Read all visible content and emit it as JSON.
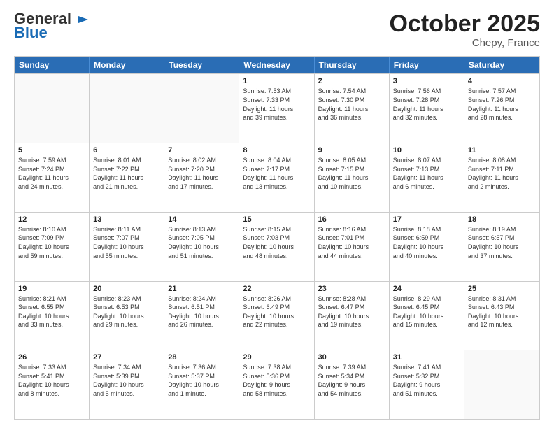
{
  "header": {
    "logo_general": "General",
    "logo_blue": "Blue",
    "month": "October 2025",
    "location": "Chepy, France"
  },
  "weekdays": [
    "Sunday",
    "Monday",
    "Tuesday",
    "Wednesday",
    "Thursday",
    "Friday",
    "Saturday"
  ],
  "rows": [
    [
      {
        "day": "",
        "info": ""
      },
      {
        "day": "",
        "info": ""
      },
      {
        "day": "",
        "info": ""
      },
      {
        "day": "1",
        "info": "Sunrise: 7:53 AM\nSunset: 7:33 PM\nDaylight: 11 hours\nand 39 minutes."
      },
      {
        "day": "2",
        "info": "Sunrise: 7:54 AM\nSunset: 7:30 PM\nDaylight: 11 hours\nand 36 minutes."
      },
      {
        "day": "3",
        "info": "Sunrise: 7:56 AM\nSunset: 7:28 PM\nDaylight: 11 hours\nand 32 minutes."
      },
      {
        "day": "4",
        "info": "Sunrise: 7:57 AM\nSunset: 7:26 PM\nDaylight: 11 hours\nand 28 minutes."
      }
    ],
    [
      {
        "day": "5",
        "info": "Sunrise: 7:59 AM\nSunset: 7:24 PM\nDaylight: 11 hours\nand 24 minutes."
      },
      {
        "day": "6",
        "info": "Sunrise: 8:01 AM\nSunset: 7:22 PM\nDaylight: 11 hours\nand 21 minutes."
      },
      {
        "day": "7",
        "info": "Sunrise: 8:02 AM\nSunset: 7:20 PM\nDaylight: 11 hours\nand 17 minutes."
      },
      {
        "day": "8",
        "info": "Sunrise: 8:04 AM\nSunset: 7:17 PM\nDaylight: 11 hours\nand 13 minutes."
      },
      {
        "day": "9",
        "info": "Sunrise: 8:05 AM\nSunset: 7:15 PM\nDaylight: 11 hours\nand 10 minutes."
      },
      {
        "day": "10",
        "info": "Sunrise: 8:07 AM\nSunset: 7:13 PM\nDaylight: 11 hours\nand 6 minutes."
      },
      {
        "day": "11",
        "info": "Sunrise: 8:08 AM\nSunset: 7:11 PM\nDaylight: 11 hours\nand 2 minutes."
      }
    ],
    [
      {
        "day": "12",
        "info": "Sunrise: 8:10 AM\nSunset: 7:09 PM\nDaylight: 10 hours\nand 59 minutes."
      },
      {
        "day": "13",
        "info": "Sunrise: 8:11 AM\nSunset: 7:07 PM\nDaylight: 10 hours\nand 55 minutes."
      },
      {
        "day": "14",
        "info": "Sunrise: 8:13 AM\nSunset: 7:05 PM\nDaylight: 10 hours\nand 51 minutes."
      },
      {
        "day": "15",
        "info": "Sunrise: 8:15 AM\nSunset: 7:03 PM\nDaylight: 10 hours\nand 48 minutes."
      },
      {
        "day": "16",
        "info": "Sunrise: 8:16 AM\nSunset: 7:01 PM\nDaylight: 10 hours\nand 44 minutes."
      },
      {
        "day": "17",
        "info": "Sunrise: 8:18 AM\nSunset: 6:59 PM\nDaylight: 10 hours\nand 40 minutes."
      },
      {
        "day": "18",
        "info": "Sunrise: 8:19 AM\nSunset: 6:57 PM\nDaylight: 10 hours\nand 37 minutes."
      }
    ],
    [
      {
        "day": "19",
        "info": "Sunrise: 8:21 AM\nSunset: 6:55 PM\nDaylight: 10 hours\nand 33 minutes."
      },
      {
        "day": "20",
        "info": "Sunrise: 8:23 AM\nSunset: 6:53 PM\nDaylight: 10 hours\nand 29 minutes."
      },
      {
        "day": "21",
        "info": "Sunrise: 8:24 AM\nSunset: 6:51 PM\nDaylight: 10 hours\nand 26 minutes."
      },
      {
        "day": "22",
        "info": "Sunrise: 8:26 AM\nSunset: 6:49 PM\nDaylight: 10 hours\nand 22 minutes."
      },
      {
        "day": "23",
        "info": "Sunrise: 8:28 AM\nSunset: 6:47 PM\nDaylight: 10 hours\nand 19 minutes."
      },
      {
        "day": "24",
        "info": "Sunrise: 8:29 AM\nSunset: 6:45 PM\nDaylight: 10 hours\nand 15 minutes."
      },
      {
        "day": "25",
        "info": "Sunrise: 8:31 AM\nSunset: 6:43 PM\nDaylight: 10 hours\nand 12 minutes."
      }
    ],
    [
      {
        "day": "26",
        "info": "Sunrise: 7:33 AM\nSunset: 5:41 PM\nDaylight: 10 hours\nand 8 minutes."
      },
      {
        "day": "27",
        "info": "Sunrise: 7:34 AM\nSunset: 5:39 PM\nDaylight: 10 hours\nand 5 minutes."
      },
      {
        "day": "28",
        "info": "Sunrise: 7:36 AM\nSunset: 5:37 PM\nDaylight: 10 hours\nand 1 minute."
      },
      {
        "day": "29",
        "info": "Sunrise: 7:38 AM\nSunset: 5:36 PM\nDaylight: 9 hours\nand 58 minutes."
      },
      {
        "day": "30",
        "info": "Sunrise: 7:39 AM\nSunset: 5:34 PM\nDaylight: 9 hours\nand 54 minutes."
      },
      {
        "day": "31",
        "info": "Sunrise: 7:41 AM\nSunset: 5:32 PM\nDaylight: 9 hours\nand 51 minutes."
      },
      {
        "day": "",
        "info": ""
      }
    ]
  ]
}
